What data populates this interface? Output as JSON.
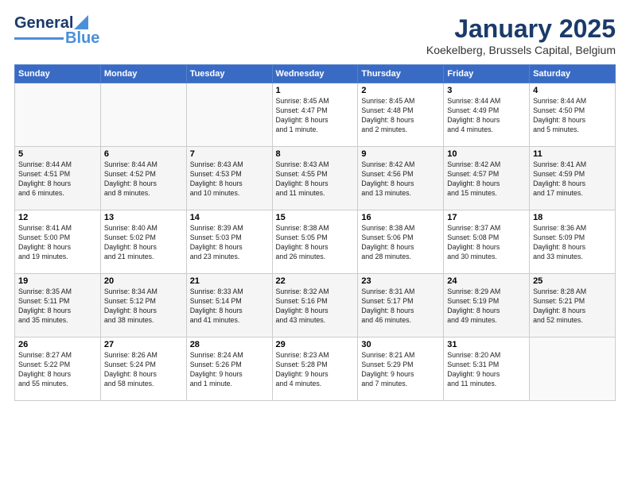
{
  "header": {
    "logo_line1": "General",
    "logo_line2": "Blue",
    "month": "January 2025",
    "location": "Koekelberg, Brussels Capital, Belgium"
  },
  "weekdays": [
    "Sunday",
    "Monday",
    "Tuesday",
    "Wednesday",
    "Thursday",
    "Friday",
    "Saturday"
  ],
  "weeks": [
    [
      {
        "day": "",
        "info": ""
      },
      {
        "day": "",
        "info": ""
      },
      {
        "day": "",
        "info": ""
      },
      {
        "day": "1",
        "info": "Sunrise: 8:45 AM\nSunset: 4:47 PM\nDaylight: 8 hours\nand 1 minute."
      },
      {
        "day": "2",
        "info": "Sunrise: 8:45 AM\nSunset: 4:48 PM\nDaylight: 8 hours\nand 2 minutes."
      },
      {
        "day": "3",
        "info": "Sunrise: 8:44 AM\nSunset: 4:49 PM\nDaylight: 8 hours\nand 4 minutes."
      },
      {
        "day": "4",
        "info": "Sunrise: 8:44 AM\nSunset: 4:50 PM\nDaylight: 8 hours\nand 5 minutes."
      }
    ],
    [
      {
        "day": "5",
        "info": "Sunrise: 8:44 AM\nSunset: 4:51 PM\nDaylight: 8 hours\nand 6 minutes."
      },
      {
        "day": "6",
        "info": "Sunrise: 8:44 AM\nSunset: 4:52 PM\nDaylight: 8 hours\nand 8 minutes."
      },
      {
        "day": "7",
        "info": "Sunrise: 8:43 AM\nSunset: 4:53 PM\nDaylight: 8 hours\nand 10 minutes."
      },
      {
        "day": "8",
        "info": "Sunrise: 8:43 AM\nSunset: 4:55 PM\nDaylight: 8 hours\nand 11 minutes."
      },
      {
        "day": "9",
        "info": "Sunrise: 8:42 AM\nSunset: 4:56 PM\nDaylight: 8 hours\nand 13 minutes."
      },
      {
        "day": "10",
        "info": "Sunrise: 8:42 AM\nSunset: 4:57 PM\nDaylight: 8 hours\nand 15 minutes."
      },
      {
        "day": "11",
        "info": "Sunrise: 8:41 AM\nSunset: 4:59 PM\nDaylight: 8 hours\nand 17 minutes."
      }
    ],
    [
      {
        "day": "12",
        "info": "Sunrise: 8:41 AM\nSunset: 5:00 PM\nDaylight: 8 hours\nand 19 minutes."
      },
      {
        "day": "13",
        "info": "Sunrise: 8:40 AM\nSunset: 5:02 PM\nDaylight: 8 hours\nand 21 minutes."
      },
      {
        "day": "14",
        "info": "Sunrise: 8:39 AM\nSunset: 5:03 PM\nDaylight: 8 hours\nand 23 minutes."
      },
      {
        "day": "15",
        "info": "Sunrise: 8:38 AM\nSunset: 5:05 PM\nDaylight: 8 hours\nand 26 minutes."
      },
      {
        "day": "16",
        "info": "Sunrise: 8:38 AM\nSunset: 5:06 PM\nDaylight: 8 hours\nand 28 minutes."
      },
      {
        "day": "17",
        "info": "Sunrise: 8:37 AM\nSunset: 5:08 PM\nDaylight: 8 hours\nand 30 minutes."
      },
      {
        "day": "18",
        "info": "Sunrise: 8:36 AM\nSunset: 5:09 PM\nDaylight: 8 hours\nand 33 minutes."
      }
    ],
    [
      {
        "day": "19",
        "info": "Sunrise: 8:35 AM\nSunset: 5:11 PM\nDaylight: 8 hours\nand 35 minutes."
      },
      {
        "day": "20",
        "info": "Sunrise: 8:34 AM\nSunset: 5:12 PM\nDaylight: 8 hours\nand 38 minutes."
      },
      {
        "day": "21",
        "info": "Sunrise: 8:33 AM\nSunset: 5:14 PM\nDaylight: 8 hours\nand 41 minutes."
      },
      {
        "day": "22",
        "info": "Sunrise: 8:32 AM\nSunset: 5:16 PM\nDaylight: 8 hours\nand 43 minutes."
      },
      {
        "day": "23",
        "info": "Sunrise: 8:31 AM\nSunset: 5:17 PM\nDaylight: 8 hours\nand 46 minutes."
      },
      {
        "day": "24",
        "info": "Sunrise: 8:29 AM\nSunset: 5:19 PM\nDaylight: 8 hours\nand 49 minutes."
      },
      {
        "day": "25",
        "info": "Sunrise: 8:28 AM\nSunset: 5:21 PM\nDaylight: 8 hours\nand 52 minutes."
      }
    ],
    [
      {
        "day": "26",
        "info": "Sunrise: 8:27 AM\nSunset: 5:22 PM\nDaylight: 8 hours\nand 55 minutes."
      },
      {
        "day": "27",
        "info": "Sunrise: 8:26 AM\nSunset: 5:24 PM\nDaylight: 8 hours\nand 58 minutes."
      },
      {
        "day": "28",
        "info": "Sunrise: 8:24 AM\nSunset: 5:26 PM\nDaylight: 9 hours\nand 1 minute."
      },
      {
        "day": "29",
        "info": "Sunrise: 8:23 AM\nSunset: 5:28 PM\nDaylight: 9 hours\nand 4 minutes."
      },
      {
        "day": "30",
        "info": "Sunrise: 8:21 AM\nSunset: 5:29 PM\nDaylight: 9 hours\nand 7 minutes."
      },
      {
        "day": "31",
        "info": "Sunrise: 8:20 AM\nSunset: 5:31 PM\nDaylight: 9 hours\nand 11 minutes."
      },
      {
        "day": "",
        "info": ""
      }
    ]
  ]
}
